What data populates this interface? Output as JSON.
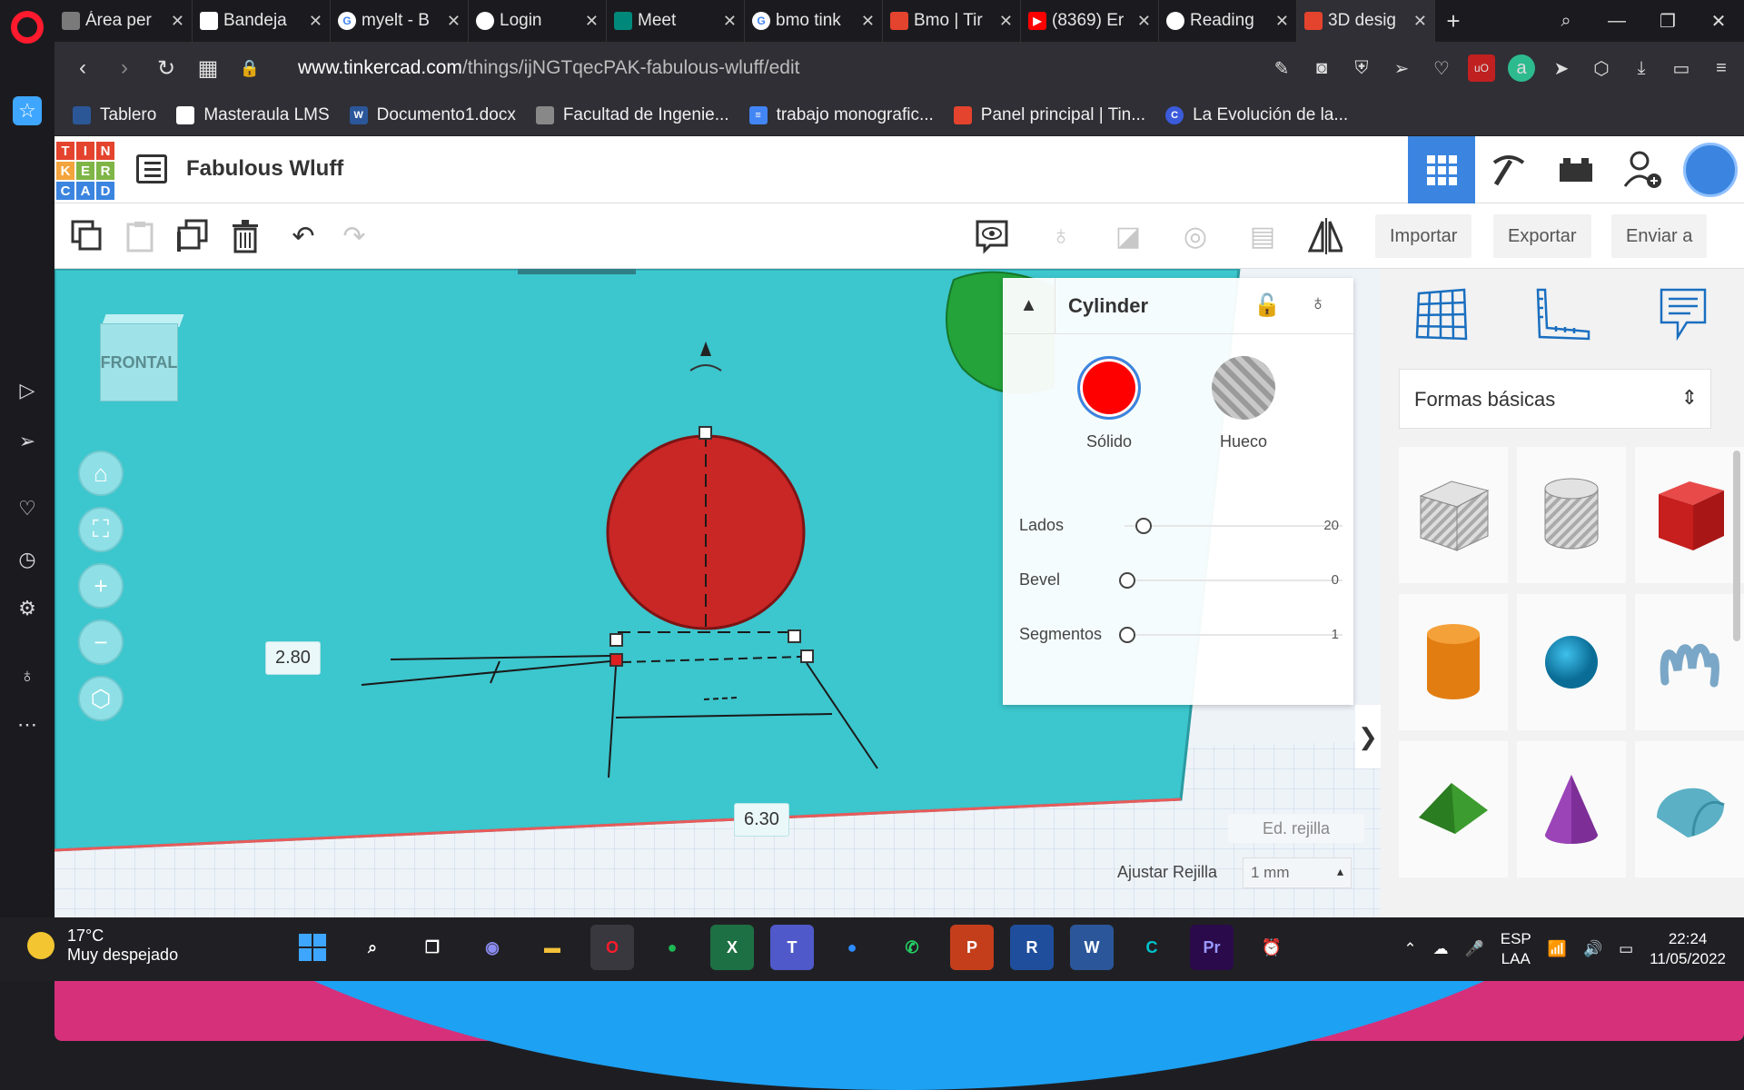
{
  "browser": {
    "tabs": [
      {
        "label": "Área per",
        "color": "#7a7a7a"
      },
      {
        "label": "Bandeja",
        "color": "#ffffff"
      },
      {
        "label": "myelt - B",
        "color": "#ffffff"
      },
      {
        "label": "Login",
        "color": "#ffffff"
      },
      {
        "label": "Meet",
        "color": "#00897b"
      },
      {
        "label": "bmo tink",
        "color": "#ffffff"
      },
      {
        "label": "Bmo | Tir",
        "color": "#e4432d"
      },
      {
        "label": "(8369) Er",
        "color": "#ff0000"
      },
      {
        "label": "Reading",
        "color": "#ffffff"
      },
      {
        "label": "3D desig",
        "color": "#e4432d"
      }
    ],
    "url_host": "www.tinkercad.com",
    "url_path": "/things/ijNGTqecPAK-fabulous-wluff/edit",
    "bookmarks": [
      {
        "label": "Tablero",
        "color": "#2b5797"
      },
      {
        "label": "Masteraula LMS",
        "color": "#ffffff"
      },
      {
        "label": "Documento1.docx",
        "color": "#2b579a"
      },
      {
        "label": "Facultad de Ingenie...",
        "color": "#888888"
      },
      {
        "label": "trabajo monografic...",
        "color": "#4285f4"
      },
      {
        "label": "Panel principal | Tin...",
        "color": "#e4432d"
      },
      {
        "label": "La Evolución de la...",
        "color": "#3b5bdb"
      }
    ]
  },
  "app": {
    "logo_letters": [
      "T",
      "I",
      "N",
      "K",
      "E",
      "R",
      "C",
      "A",
      "D"
    ],
    "design_title": "Fabulous Wluff",
    "toolbar": {
      "import_label": "Importar",
      "export_label": "Exportar",
      "send_label": "Enviar a"
    },
    "viewcube_label": "FRONTAL",
    "dim_height": "2.80",
    "dim_width": "6.30",
    "inspector": {
      "title": "Cylinder",
      "solid_label": "Sólido",
      "hole_label": "Hueco",
      "solid_color": "#ff0000",
      "props": [
        {
          "label": "Lados",
          "value": "20"
        },
        {
          "label": "Bevel",
          "value": "0"
        },
        {
          "label": "Segmentos",
          "value": "1"
        }
      ]
    },
    "grid_edit_label": "Ed. rejilla",
    "snap_label": "Ajustar Rejilla",
    "snap_value": "1 mm",
    "library": {
      "category": "Formas básicas",
      "shapes": [
        "box-hole",
        "cylinder-hole",
        "box",
        "cylinder",
        "sphere",
        "scribble",
        "roof",
        "cone",
        "round-roof"
      ]
    }
  },
  "taskbar": {
    "temperature": "17°C",
    "weather": "Muy despejado",
    "lang1": "ESP",
    "lang2": "LAA",
    "time": "22:24",
    "date": "11/05/2022"
  }
}
